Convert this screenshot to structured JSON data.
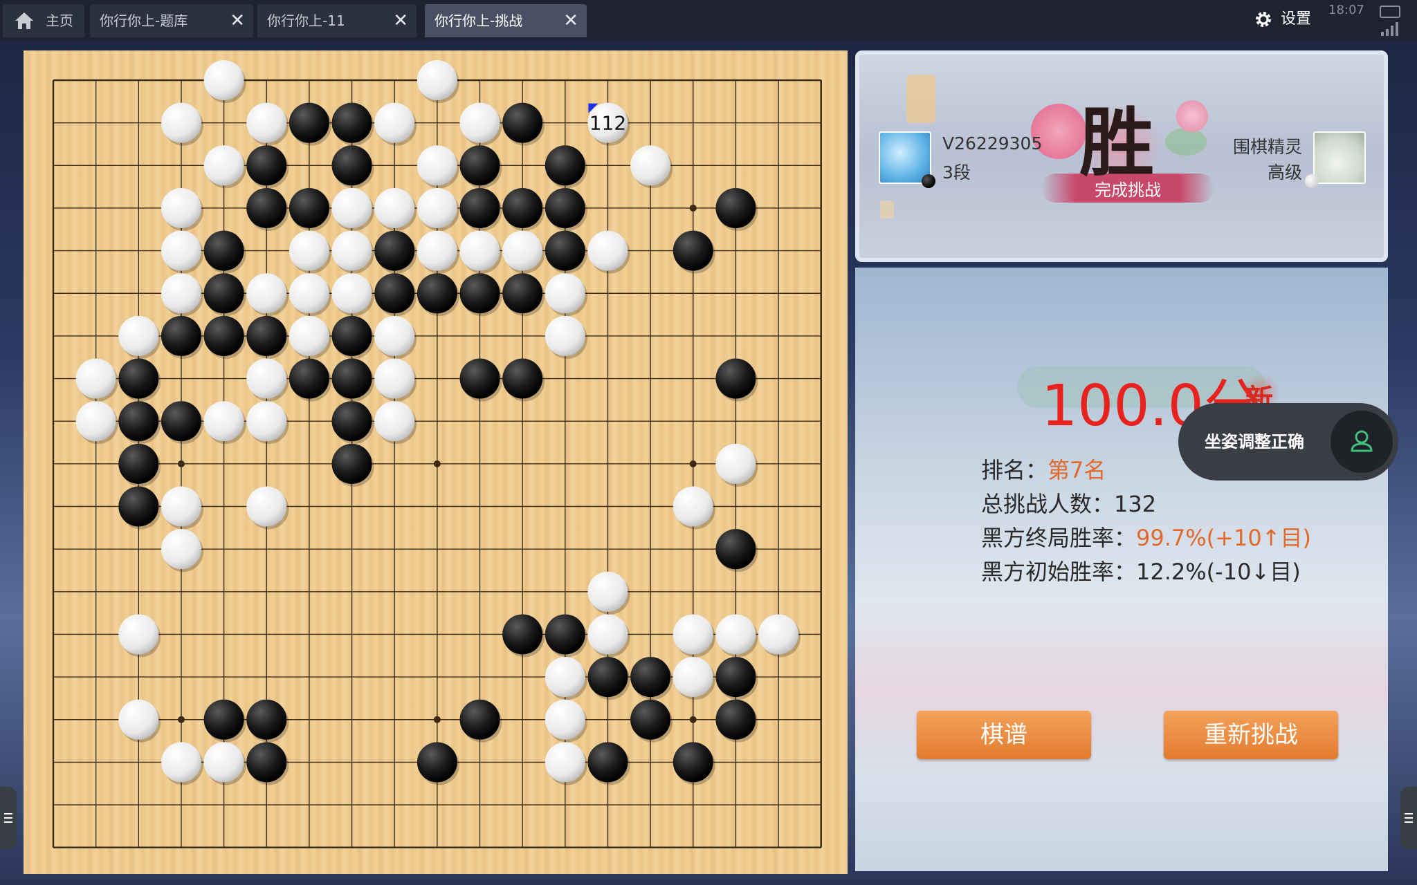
{
  "tabs": [
    {
      "label": "主页",
      "active": false,
      "closable": false
    },
    {
      "label": "你行你上-题库",
      "active": false,
      "closable": true
    },
    {
      "label": "你行你上-11",
      "active": false,
      "closable": true
    },
    {
      "label": "你行你上-挑战",
      "active": true,
      "closable": true
    }
  ],
  "close_glyph": "✕",
  "settings_label": "设置",
  "status": {
    "time": "18:07"
  },
  "board": {
    "size": 19,
    "last_move_number": "112",
    "last_move_coord": [
      13,
      1
    ],
    "black_stones": [
      [
        6,
        1
      ],
      [
        7,
        1
      ],
      [
        11,
        1
      ],
      [
        5,
        2
      ],
      [
        7,
        2
      ],
      [
        10,
        2
      ],
      [
        12,
        2
      ],
      [
        5,
        3
      ],
      [
        6,
        3
      ],
      [
        10,
        3
      ],
      [
        11,
        3
      ],
      [
        12,
        3
      ],
      [
        16,
        3
      ],
      [
        4,
        4
      ],
      [
        8,
        4
      ],
      [
        12,
        4
      ],
      [
        15,
        4
      ],
      [
        4,
        5
      ],
      [
        8,
        5
      ],
      [
        9,
        5
      ],
      [
        10,
        5
      ],
      [
        11,
        5
      ],
      [
        3,
        6
      ],
      [
        4,
        6
      ],
      [
        5,
        6
      ],
      [
        7,
        6
      ],
      [
        2,
        7
      ],
      [
        6,
        7
      ],
      [
        7,
        7
      ],
      [
        10,
        7
      ],
      [
        11,
        7
      ],
      [
        16,
        7
      ],
      [
        2,
        8
      ],
      [
        3,
        8
      ],
      [
        7,
        8
      ],
      [
        2,
        9
      ],
      [
        7,
        9
      ],
      [
        2,
        10
      ],
      [
        16,
        11
      ],
      [
        11,
        13
      ],
      [
        12,
        13
      ],
      [
        13,
        14
      ],
      [
        14,
        14
      ],
      [
        16,
        14
      ],
      [
        4,
        15
      ],
      [
        5,
        15
      ],
      [
        10,
        15
      ],
      [
        14,
        15
      ],
      [
        16,
        15
      ],
      [
        5,
        16
      ],
      [
        9,
        16
      ],
      [
        13,
        16
      ],
      [
        15,
        16
      ]
    ],
    "white_stones": [
      [
        4,
        0
      ],
      [
        9,
        0
      ],
      [
        3,
        1
      ],
      [
        5,
        1
      ],
      [
        8,
        1
      ],
      [
        10,
        1
      ],
      [
        13,
        1
      ],
      [
        4,
        2
      ],
      [
        9,
        2
      ],
      [
        14,
        2
      ],
      [
        3,
        3
      ],
      [
        7,
        3
      ],
      [
        8,
        3
      ],
      [
        9,
        3
      ],
      [
        3,
        4
      ],
      [
        6,
        4
      ],
      [
        7,
        4
      ],
      [
        9,
        4
      ],
      [
        10,
        4
      ],
      [
        11,
        4
      ],
      [
        13,
        4
      ],
      [
        3,
        5
      ],
      [
        5,
        5
      ],
      [
        6,
        5
      ],
      [
        7,
        5
      ],
      [
        12,
        5
      ],
      [
        2,
        6
      ],
      [
        6,
        6
      ],
      [
        8,
        6
      ],
      [
        12,
        6
      ],
      [
        1,
        7
      ],
      [
        5,
        7
      ],
      [
        8,
        7
      ],
      [
        1,
        8
      ],
      [
        4,
        8
      ],
      [
        5,
        8
      ],
      [
        8,
        8
      ],
      [
        16,
        9
      ],
      [
        3,
        10
      ],
      [
        5,
        10
      ],
      [
        15,
        10
      ],
      [
        3,
        11
      ],
      [
        13,
        12
      ],
      [
        2,
        13
      ],
      [
        13,
        13
      ],
      [
        15,
        13
      ],
      [
        16,
        13
      ],
      [
        17,
        13
      ],
      [
        12,
        14
      ],
      [
        15,
        14
      ],
      [
        2,
        15
      ],
      [
        12,
        15
      ],
      [
        3,
        16
      ],
      [
        4,
        16
      ],
      [
        12,
        16
      ]
    ],
    "star_points": [
      [
        3,
        3
      ],
      [
        9,
        3
      ],
      [
        15,
        3
      ],
      [
        3,
        9
      ],
      [
        9,
        9
      ],
      [
        15,
        9
      ],
      [
        3,
        15
      ],
      [
        9,
        15
      ],
      [
        15,
        15
      ]
    ]
  },
  "players": {
    "left": {
      "name": "V26229305",
      "rank": "3段",
      "color": "black"
    },
    "right": {
      "name": "围棋精灵",
      "rank": "高级",
      "color": "white"
    }
  },
  "result": {
    "char": "胜",
    "subtitle": "完成挑战"
  },
  "score": {
    "value": "100.0分",
    "badge": "新"
  },
  "stats": [
    {
      "label": "排名：",
      "value": "第7名",
      "highlight": true
    },
    {
      "label": "总挑战人数：",
      "value": "132",
      "highlight": false
    },
    {
      "label": "黑方终局胜率：",
      "value": "99.7%(+10↑目)",
      "highlight": true
    },
    {
      "label": "黑方初始胜率：",
      "value": "12.2%(-10↓目)",
      "highlight": false
    }
  ],
  "buttons": {
    "record": "棋谱",
    "retry": "重新挑战"
  },
  "toast": {
    "text": "坐姿调整正确"
  },
  "colors": {
    "score_red": "#e8231f",
    "stat_orange": "#e2682b",
    "button_orange": "#e8893a",
    "board_wood": "#eec88c"
  }
}
